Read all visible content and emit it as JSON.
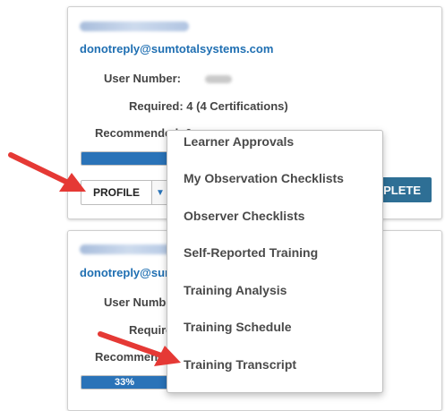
{
  "card1": {
    "email": "donotreply@sumtotalsystems.com",
    "user_number_label": "User Number:",
    "required_label": "Required: 4 (4 Certifications)",
    "recommended_label": "Recommended: 0",
    "profile_label": "PROFILE",
    "complete_label": "COMPLETE"
  },
  "card2": {
    "email": "donotreply@sumtotalsystems.com",
    "user_number_label": "User Number:",
    "required_label": "Required:",
    "recommended_label": "Recommended:",
    "progress_value": 33,
    "progress_label": "33%"
  },
  "menu": {
    "items": [
      "Learner Approvals",
      "My Observation Checklists",
      "Observer Checklists",
      "Self-Reported Training",
      "Training Analysis",
      "Training Schedule",
      "Training Transcript"
    ]
  },
  "colors": {
    "link": "#1f6fb2",
    "progress": "#2a73b8",
    "complete_button": "#2e6f95",
    "annotation_arrow": "#e53935"
  }
}
